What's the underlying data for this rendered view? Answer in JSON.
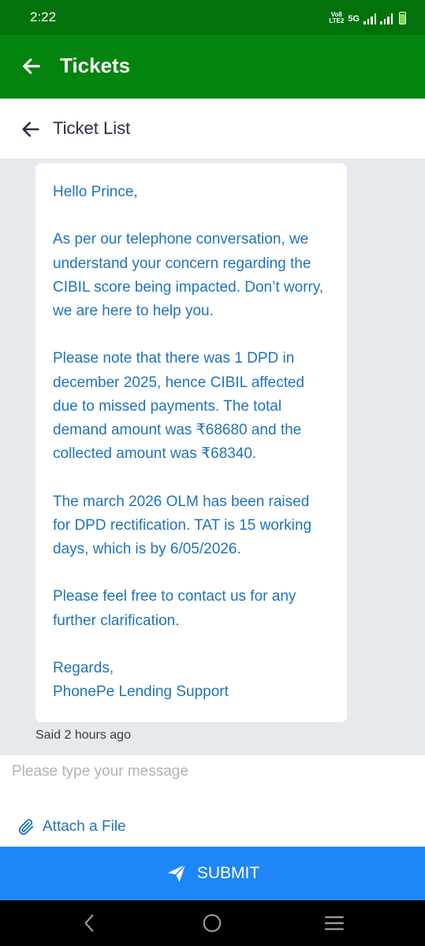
{
  "status_bar": {
    "time": "2:22",
    "network_label_top": "Vo8",
    "network_label_bottom": "LTE2",
    "network_type": "5G",
    "battery_level": 0.85
  },
  "app_bar": {
    "title": "Tickets",
    "back_icon": "arrow-left-icon"
  },
  "sub_header": {
    "title": "Ticket List",
    "back_icon": "arrow-left-icon"
  },
  "message": {
    "paragraphs": [
      "Hello Prince,",
      "As per our telephone conversation, we understand your concern regarding the CIBIL score being impacted. Don’t worry, we are here to help you.",
      "Please note that there was 1 DPD in december 2025, hence CIBIL affected due to missed payments. The total demand amount was ₹68680 and the collected amount was ₹68340.",
      "The march 2026 OLM has been raised for DPD rectification. TAT is 15 working days, which is by 6/05/2026.",
      "Please feel free to contact us for any further clarification.",
      "Regards,\nPhonePe Lending Support"
    ],
    "time_ago": "Said 2 hours ago"
  },
  "composer": {
    "placeholder": "Please type your message",
    "value": "",
    "attach_label": "Attach a File",
    "attach_icon": "paperclip-icon"
  },
  "submit": {
    "label": "SUBMIT",
    "icon": "send-icon"
  },
  "colors": {
    "status_bar": "#02720a",
    "app_bar": "#03840f",
    "accent_text": "#1f74b9",
    "submit": "#1f86f8",
    "background": "#e6e9ee"
  }
}
